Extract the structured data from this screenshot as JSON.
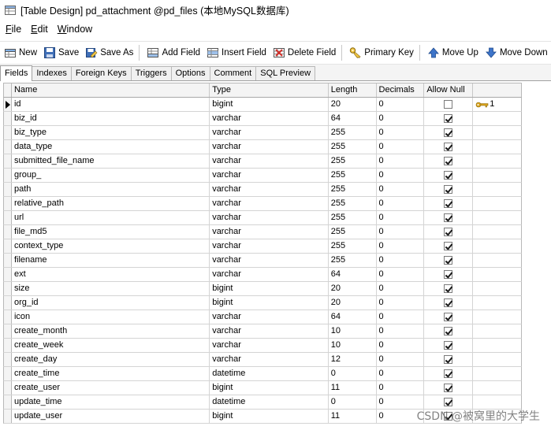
{
  "window": {
    "title": "[Table Design] pd_attachment @pd_files (本地MySQL数据库)"
  },
  "menu": [
    {
      "label": "File",
      "hotkey": "F",
      "rest": "ile"
    },
    {
      "label": "Edit",
      "hotkey": "E",
      "rest": "dit"
    },
    {
      "label": "Window",
      "hotkey": "W",
      "rest": "indow"
    }
  ],
  "toolbar": {
    "new": "New",
    "save": "Save",
    "save_as": "Save As",
    "add_field": "Add Field",
    "insert_field": "Insert Field",
    "delete_field": "Delete Field",
    "primary_key": "Primary Key",
    "move_up": "Move Up",
    "move_down": "Move Down"
  },
  "tabs": [
    "Fields",
    "Indexes",
    "Foreign Keys",
    "Triggers",
    "Options",
    "Comment",
    "SQL Preview"
  ],
  "columns": [
    "Name",
    "Type",
    "Length",
    "Decimals",
    "Allow Null",
    ""
  ],
  "rows": [
    {
      "name": "id",
      "type": "bigint",
      "length": "20",
      "decimals": "0",
      "allow_null": false,
      "key": "1"
    },
    {
      "name": "biz_id",
      "type": "varchar",
      "length": "64",
      "decimals": "0",
      "allow_null": true,
      "key": ""
    },
    {
      "name": "biz_type",
      "type": "varchar",
      "length": "255",
      "decimals": "0",
      "allow_null": true,
      "key": ""
    },
    {
      "name": "data_type",
      "type": "varchar",
      "length": "255",
      "decimals": "0",
      "allow_null": true,
      "key": ""
    },
    {
      "name": "submitted_file_name",
      "type": "varchar",
      "length": "255",
      "decimals": "0",
      "allow_null": true,
      "key": ""
    },
    {
      "name": "group_",
      "type": "varchar",
      "length": "255",
      "decimals": "0",
      "allow_null": true,
      "key": ""
    },
    {
      "name": "path",
      "type": "varchar",
      "length": "255",
      "decimals": "0",
      "allow_null": true,
      "key": ""
    },
    {
      "name": "relative_path",
      "type": "varchar",
      "length": "255",
      "decimals": "0",
      "allow_null": true,
      "key": ""
    },
    {
      "name": "url",
      "type": "varchar",
      "length": "255",
      "decimals": "0",
      "allow_null": true,
      "key": ""
    },
    {
      "name": "file_md5",
      "type": "varchar",
      "length": "255",
      "decimals": "0",
      "allow_null": true,
      "key": ""
    },
    {
      "name": "context_type",
      "type": "varchar",
      "length": "255",
      "decimals": "0",
      "allow_null": true,
      "key": ""
    },
    {
      "name": "filename",
      "type": "varchar",
      "length": "255",
      "decimals": "0",
      "allow_null": true,
      "key": ""
    },
    {
      "name": "ext",
      "type": "varchar",
      "length": "64",
      "decimals": "0",
      "allow_null": true,
      "key": ""
    },
    {
      "name": "size",
      "type": "bigint",
      "length": "20",
      "decimals": "0",
      "allow_null": true,
      "key": ""
    },
    {
      "name": "org_id",
      "type": "bigint",
      "length": "20",
      "decimals": "0",
      "allow_null": true,
      "key": ""
    },
    {
      "name": "icon",
      "type": "varchar",
      "length": "64",
      "decimals": "0",
      "allow_null": true,
      "key": ""
    },
    {
      "name": "create_month",
      "type": "varchar",
      "length": "10",
      "decimals": "0",
      "allow_null": true,
      "key": ""
    },
    {
      "name": "create_week",
      "type": "varchar",
      "length": "10",
      "decimals": "0",
      "allow_null": true,
      "key": ""
    },
    {
      "name": "create_day",
      "type": "varchar",
      "length": "12",
      "decimals": "0",
      "allow_null": true,
      "key": ""
    },
    {
      "name": "create_time",
      "type": "datetime",
      "length": "0",
      "decimals": "0",
      "allow_null": true,
      "key": ""
    },
    {
      "name": "create_user",
      "type": "bigint",
      "length": "11",
      "decimals": "0",
      "allow_null": true,
      "key": ""
    },
    {
      "name": "update_time",
      "type": "datetime",
      "length": "0",
      "decimals": "0",
      "allow_null": true,
      "key": ""
    },
    {
      "name": "update_user",
      "type": "bigint",
      "length": "11",
      "decimals": "0",
      "allow_null": true,
      "key": ""
    }
  ],
  "watermark": "CSDN @被窝里的大学生",
  "colors": {
    "key_gold": "#d9a21b",
    "grid_line": "#d4d4d4"
  }
}
